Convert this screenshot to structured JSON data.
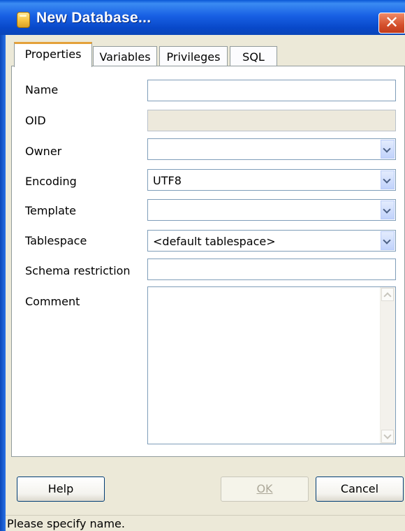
{
  "window": {
    "title": "New Database...",
    "close_glyph": "✕"
  },
  "tabs": [
    {
      "label": "Properties",
      "active": true
    },
    {
      "label": "Variables",
      "active": false
    },
    {
      "label": "Privileges",
      "active": false
    },
    {
      "label": "SQL",
      "active": false
    }
  ],
  "form": {
    "name": {
      "label": "Name",
      "value": ""
    },
    "oid": {
      "label": "OID",
      "value": "",
      "disabled": true
    },
    "owner": {
      "label": "Owner",
      "value": ""
    },
    "encoding": {
      "label": "Encoding",
      "value": "UTF8"
    },
    "template": {
      "label": "Template",
      "value": ""
    },
    "tablespace": {
      "label": "Tablespace",
      "value": "<default tablespace>"
    },
    "schema_restriction": {
      "label": "Schema restriction",
      "value": ""
    },
    "comment": {
      "label": "Comment",
      "value": ""
    }
  },
  "buttons": {
    "help": "Help",
    "ok": "OK",
    "cancel": "Cancel"
  },
  "status_text": "Please specify name.",
  "colors": {
    "titlebar": "#0A57D6",
    "dialog_bg": "#ECE9D8",
    "active_tab_accent": "#E4A13A",
    "field_border": "#7F9DB9"
  },
  "icons": {
    "window_icon": "database-icon",
    "close": "close-icon",
    "dropdown": "chevron-down-icon"
  }
}
